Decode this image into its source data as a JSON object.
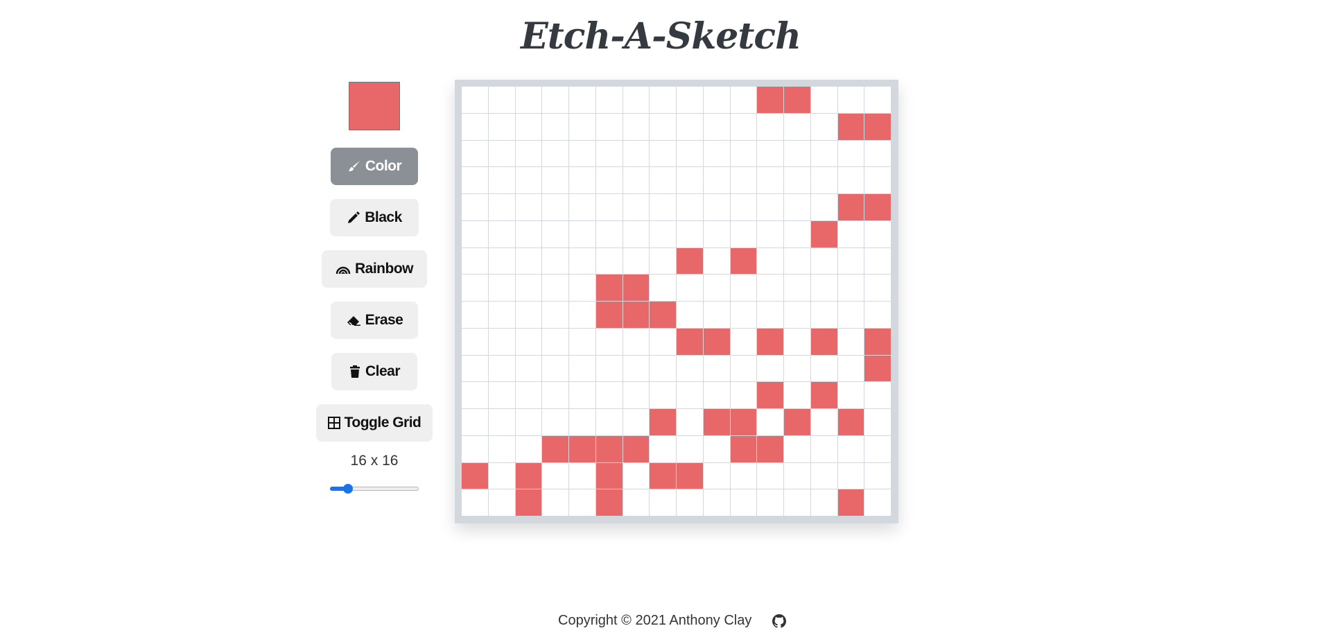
{
  "header": {
    "title": "Etch-A-Sketch"
  },
  "colors": {
    "selected": "#e8686a",
    "grid_line": "#d3d8de",
    "accent": "#1a73e8"
  },
  "controls": {
    "buttons": [
      {
        "id": "color",
        "label": "Color",
        "icon": "paintbrush-icon",
        "active": true
      },
      {
        "id": "black",
        "label": "Black",
        "icon": "pencil-icon",
        "active": false
      },
      {
        "id": "rainbow",
        "label": "Rainbow",
        "icon": "rainbow-icon",
        "active": false
      },
      {
        "id": "erase",
        "label": "Erase",
        "icon": "eraser-icon",
        "active": false
      },
      {
        "id": "clear",
        "label": "Clear",
        "icon": "trash-icon",
        "active": false
      },
      {
        "id": "toggle-grid",
        "label": "Toggle Grid",
        "icon": "grid-icon",
        "active": false
      }
    ],
    "size_label": "16 x 16",
    "grid_size": 16,
    "slider_value_fraction": 0.17
  },
  "grid": {
    "rows": 16,
    "cols": 16,
    "painted": [
      [
        0,
        11
      ],
      [
        0,
        12
      ],
      [
        1,
        14
      ],
      [
        1,
        15
      ],
      [
        4,
        14
      ],
      [
        4,
        15
      ],
      [
        5,
        13
      ],
      [
        6,
        8
      ],
      [
        6,
        10
      ],
      [
        7,
        5
      ],
      [
        7,
        6
      ],
      [
        8,
        5
      ],
      [
        8,
        6
      ],
      [
        8,
        7
      ],
      [
        9,
        8
      ],
      [
        9,
        9
      ],
      [
        9,
        11
      ],
      [
        9,
        13
      ],
      [
        9,
        15
      ],
      [
        10,
        15
      ],
      [
        11,
        11
      ],
      [
        11,
        13
      ],
      [
        12,
        7
      ],
      [
        12,
        9
      ],
      [
        12,
        10
      ],
      [
        12,
        12
      ],
      [
        12,
        14
      ],
      [
        13,
        3
      ],
      [
        13,
        4
      ],
      [
        13,
        5
      ],
      [
        13,
        6
      ],
      [
        13,
        10
      ],
      [
        13,
        11
      ],
      [
        14,
        0
      ],
      [
        14,
        2
      ],
      [
        14,
        5
      ],
      [
        14,
        7
      ],
      [
        14,
        8
      ],
      [
        15,
        2
      ],
      [
        15,
        5
      ],
      [
        15,
        14
      ]
    ]
  },
  "footer": {
    "copyright": "Copyright © 2021 Anthony Clay",
    "icon": "github-icon"
  }
}
